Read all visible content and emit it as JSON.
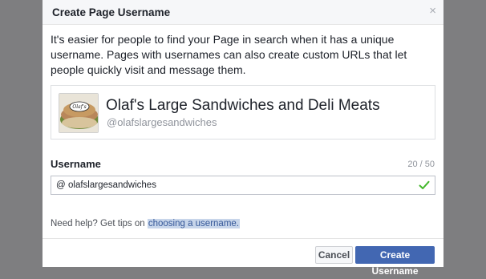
{
  "dialog": {
    "title": "Create Page Username",
    "close_symbol": "×",
    "description": "It's easier for people to find your Page in search when it has a unique username. Pages with usernames can also create custom URLs that let people quickly visit and message them."
  },
  "page_preview": {
    "thumbnail_text": "Olaf's",
    "name": "Olaf's Large Sandwiches and Deli Meats",
    "handle": "@olafslargesandwiches"
  },
  "username_field": {
    "label": "Username",
    "char_count": "20 / 50",
    "prefix": "@",
    "value": "olafslargesandwiches",
    "status_icon": "check-icon",
    "status_color": "#42b72a"
  },
  "help": {
    "prefix": "Need help? Get tips on ",
    "link": "choosing a username."
  },
  "footer": {
    "cancel_label": "Cancel",
    "create_label": "Create Username"
  },
  "colors": {
    "primary_button": "#4267b2",
    "link": "#365899",
    "link_highlight": "#c7d5ea"
  }
}
